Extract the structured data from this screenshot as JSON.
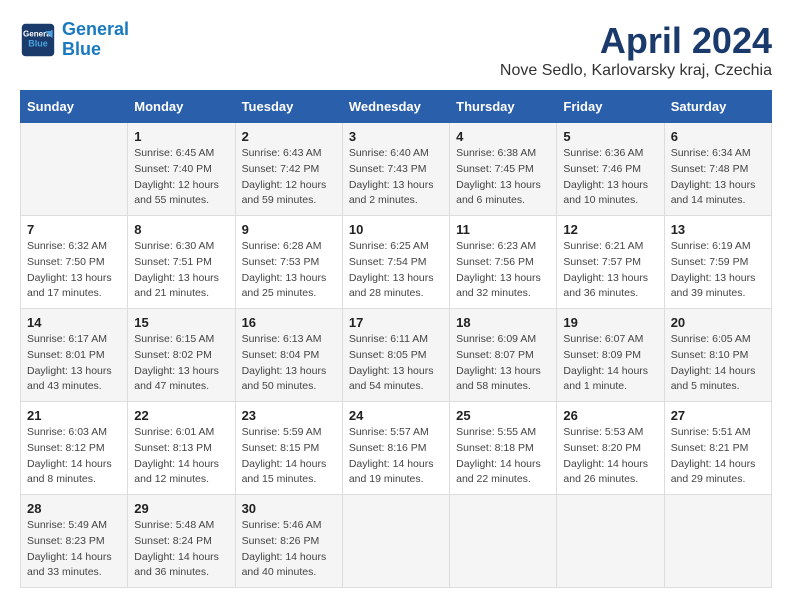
{
  "header": {
    "logo_line1": "General",
    "logo_line2": "Blue",
    "month_title": "April 2024",
    "location": "Nove Sedlo, Karlovarsky kraj, Czechia"
  },
  "days_of_week": [
    "Sunday",
    "Monday",
    "Tuesday",
    "Wednesday",
    "Thursday",
    "Friday",
    "Saturday"
  ],
  "weeks": [
    [
      {
        "day": "",
        "info": ""
      },
      {
        "day": "1",
        "info": "Sunrise: 6:45 AM\nSunset: 7:40 PM\nDaylight: 12 hours\nand 55 minutes."
      },
      {
        "day": "2",
        "info": "Sunrise: 6:43 AM\nSunset: 7:42 PM\nDaylight: 12 hours\nand 59 minutes."
      },
      {
        "day": "3",
        "info": "Sunrise: 6:40 AM\nSunset: 7:43 PM\nDaylight: 13 hours\nand 2 minutes."
      },
      {
        "day": "4",
        "info": "Sunrise: 6:38 AM\nSunset: 7:45 PM\nDaylight: 13 hours\nand 6 minutes."
      },
      {
        "day": "5",
        "info": "Sunrise: 6:36 AM\nSunset: 7:46 PM\nDaylight: 13 hours\nand 10 minutes."
      },
      {
        "day": "6",
        "info": "Sunrise: 6:34 AM\nSunset: 7:48 PM\nDaylight: 13 hours\nand 14 minutes."
      }
    ],
    [
      {
        "day": "7",
        "info": "Sunrise: 6:32 AM\nSunset: 7:50 PM\nDaylight: 13 hours\nand 17 minutes."
      },
      {
        "day": "8",
        "info": "Sunrise: 6:30 AM\nSunset: 7:51 PM\nDaylight: 13 hours\nand 21 minutes."
      },
      {
        "day": "9",
        "info": "Sunrise: 6:28 AM\nSunset: 7:53 PM\nDaylight: 13 hours\nand 25 minutes."
      },
      {
        "day": "10",
        "info": "Sunrise: 6:25 AM\nSunset: 7:54 PM\nDaylight: 13 hours\nand 28 minutes."
      },
      {
        "day": "11",
        "info": "Sunrise: 6:23 AM\nSunset: 7:56 PM\nDaylight: 13 hours\nand 32 minutes."
      },
      {
        "day": "12",
        "info": "Sunrise: 6:21 AM\nSunset: 7:57 PM\nDaylight: 13 hours\nand 36 minutes."
      },
      {
        "day": "13",
        "info": "Sunrise: 6:19 AM\nSunset: 7:59 PM\nDaylight: 13 hours\nand 39 minutes."
      }
    ],
    [
      {
        "day": "14",
        "info": "Sunrise: 6:17 AM\nSunset: 8:01 PM\nDaylight: 13 hours\nand 43 minutes."
      },
      {
        "day": "15",
        "info": "Sunrise: 6:15 AM\nSunset: 8:02 PM\nDaylight: 13 hours\nand 47 minutes."
      },
      {
        "day": "16",
        "info": "Sunrise: 6:13 AM\nSunset: 8:04 PM\nDaylight: 13 hours\nand 50 minutes."
      },
      {
        "day": "17",
        "info": "Sunrise: 6:11 AM\nSunset: 8:05 PM\nDaylight: 13 hours\nand 54 minutes."
      },
      {
        "day": "18",
        "info": "Sunrise: 6:09 AM\nSunset: 8:07 PM\nDaylight: 13 hours\nand 58 minutes."
      },
      {
        "day": "19",
        "info": "Sunrise: 6:07 AM\nSunset: 8:09 PM\nDaylight: 14 hours\nand 1 minute."
      },
      {
        "day": "20",
        "info": "Sunrise: 6:05 AM\nSunset: 8:10 PM\nDaylight: 14 hours\nand 5 minutes."
      }
    ],
    [
      {
        "day": "21",
        "info": "Sunrise: 6:03 AM\nSunset: 8:12 PM\nDaylight: 14 hours\nand 8 minutes."
      },
      {
        "day": "22",
        "info": "Sunrise: 6:01 AM\nSunset: 8:13 PM\nDaylight: 14 hours\nand 12 minutes."
      },
      {
        "day": "23",
        "info": "Sunrise: 5:59 AM\nSunset: 8:15 PM\nDaylight: 14 hours\nand 15 minutes."
      },
      {
        "day": "24",
        "info": "Sunrise: 5:57 AM\nSunset: 8:16 PM\nDaylight: 14 hours\nand 19 minutes."
      },
      {
        "day": "25",
        "info": "Sunrise: 5:55 AM\nSunset: 8:18 PM\nDaylight: 14 hours\nand 22 minutes."
      },
      {
        "day": "26",
        "info": "Sunrise: 5:53 AM\nSunset: 8:20 PM\nDaylight: 14 hours\nand 26 minutes."
      },
      {
        "day": "27",
        "info": "Sunrise: 5:51 AM\nSunset: 8:21 PM\nDaylight: 14 hours\nand 29 minutes."
      }
    ],
    [
      {
        "day": "28",
        "info": "Sunrise: 5:49 AM\nSunset: 8:23 PM\nDaylight: 14 hours\nand 33 minutes."
      },
      {
        "day": "29",
        "info": "Sunrise: 5:48 AM\nSunset: 8:24 PM\nDaylight: 14 hours\nand 36 minutes."
      },
      {
        "day": "30",
        "info": "Sunrise: 5:46 AM\nSunset: 8:26 PM\nDaylight: 14 hours\nand 40 minutes."
      },
      {
        "day": "",
        "info": ""
      },
      {
        "day": "",
        "info": ""
      },
      {
        "day": "",
        "info": ""
      },
      {
        "day": "",
        "info": ""
      }
    ]
  ]
}
